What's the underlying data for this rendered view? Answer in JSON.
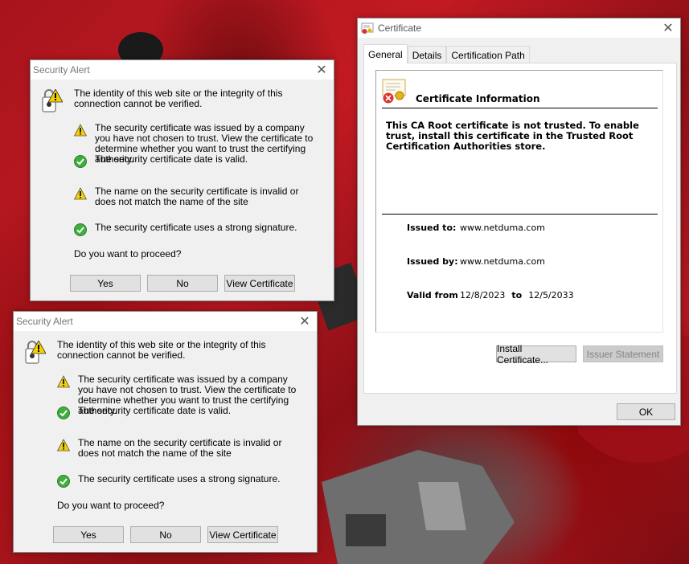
{
  "alert": {
    "title": "Security Alert",
    "close_glyph": "✕",
    "intro": "The identity of this web site or the integrity of this connection cannot be verified.",
    "items": [
      {
        "icon": "warning-icon",
        "text": "The security certificate was issued by a company you have not chosen to trust. View the certificate to determine whether you want to trust the certifying authority."
      },
      {
        "icon": "check-icon",
        "text": "The security certificate date is valid."
      },
      {
        "icon": "warning-icon",
        "text": "The name on the security certificate is invalid or does not match the name of the site"
      },
      {
        "icon": "check-icon",
        "text": "The security certificate uses a strong signature."
      }
    ],
    "question": "Do you want to proceed?",
    "buttons": {
      "yes": "Yes",
      "no": "No",
      "view": "View Certificate"
    }
  },
  "certificate": {
    "title": "Certificate",
    "close_glyph": "✕",
    "tabs": [
      "General",
      "Details",
      "Certification Path"
    ],
    "info_title": "Certificate Information",
    "warning": "This CA Root certificate is not trusted. To enable trust, install this certificate in the Trusted Root Certification Authorities store.",
    "issued_to_label": "Issued to:",
    "issued_to": "www.netduma.com",
    "issued_by_label": "Issued by:",
    "issued_by": "www.netduma.com",
    "valid_from_label": "Valid from",
    "valid_from": "12/8/2023",
    "to_label": "to",
    "valid_to": "12/5/2033",
    "buttons": {
      "install": "Install Certificate...",
      "issuer": "Issuer Statement",
      "ok": "OK"
    }
  },
  "colors": {
    "warning": "#f5d000",
    "check": "#3fae3f",
    "background": "#b3171f"
  }
}
